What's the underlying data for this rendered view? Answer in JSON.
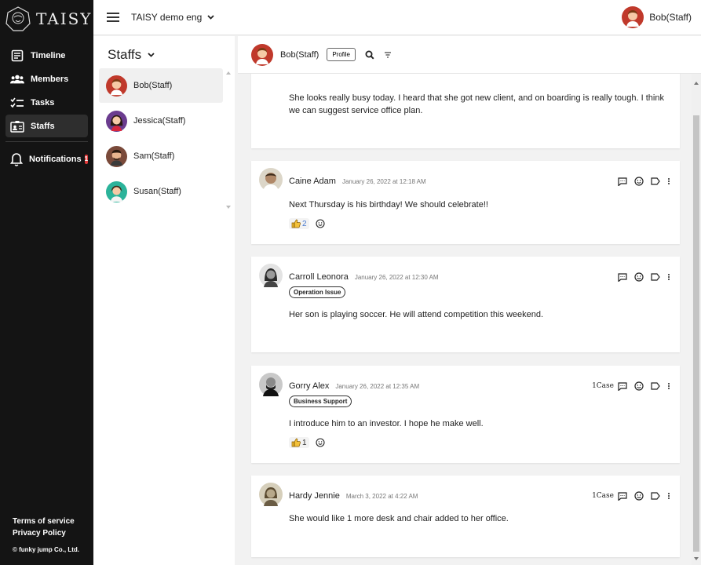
{
  "app": {
    "logo_text": "TAISY"
  },
  "sidebar": {
    "items": [
      {
        "label": "Timeline",
        "icon": "timeline-icon"
      },
      {
        "label": "Members",
        "icon": "members-icon"
      },
      {
        "label": "Tasks",
        "icon": "tasks-icon"
      },
      {
        "label": "Staffs",
        "icon": "staffs-icon",
        "active": true
      }
    ],
    "notifications": {
      "label": "Notifications",
      "count": "1"
    },
    "footer": {
      "terms": "Terms of service",
      "privacy": "Privacy Policy",
      "copyright": "© funky jump Co., Ltd."
    }
  },
  "header": {
    "workspace": "TAISY demo eng",
    "user_name": "Bob(Staff)"
  },
  "staff_panel": {
    "title": "Staffs",
    "staff": [
      {
        "name": "Bob(Staff)",
        "active": true
      },
      {
        "name": "Jessica(Staff)"
      },
      {
        "name": "Sam(Staff)"
      },
      {
        "name": "Susan(Staff)"
      }
    ]
  },
  "chat_header": {
    "name": "Bob(Staff)",
    "profile_label": "Profile"
  },
  "posts": [
    {
      "author": "",
      "time": "",
      "tag": "",
      "body": "She looks really busy today. I heard that she got new client, and on boarding is really tough. I think we can suggest service office plan.",
      "case": ""
    },
    {
      "author": "Caine Adam",
      "time": "January 26, 2022 at 12:18 AM",
      "tag": "",
      "body": "Next Thursday is his birthday! We should celebrate!!",
      "reaction_count": "2",
      "case": ""
    },
    {
      "author": "Carroll Leonora",
      "time": "January 26, 2022 at 12:30 AM",
      "tag": "Operation Issue",
      "body": "Her son is playing soccer. He will attend competition this weekend.",
      "case": ""
    },
    {
      "author": "Gorry Alex",
      "time": "January 26, 2022 at 12:35 AM",
      "tag": "Business Support",
      "body": "I introduce him to an investor. I hope he make well.",
      "reaction_count": "1",
      "case": "1Case"
    },
    {
      "author": "Hardy Jennie",
      "time": "March 3, 2022 at 4:22 AM",
      "tag": "",
      "body": "She would like 1 more desk and chair added to her office.",
      "case": "1Case"
    }
  ],
  "colors": {
    "sidebar_bg": "#141414",
    "badge_red": "#e23a3a",
    "avatar_red": "#c0392b"
  }
}
